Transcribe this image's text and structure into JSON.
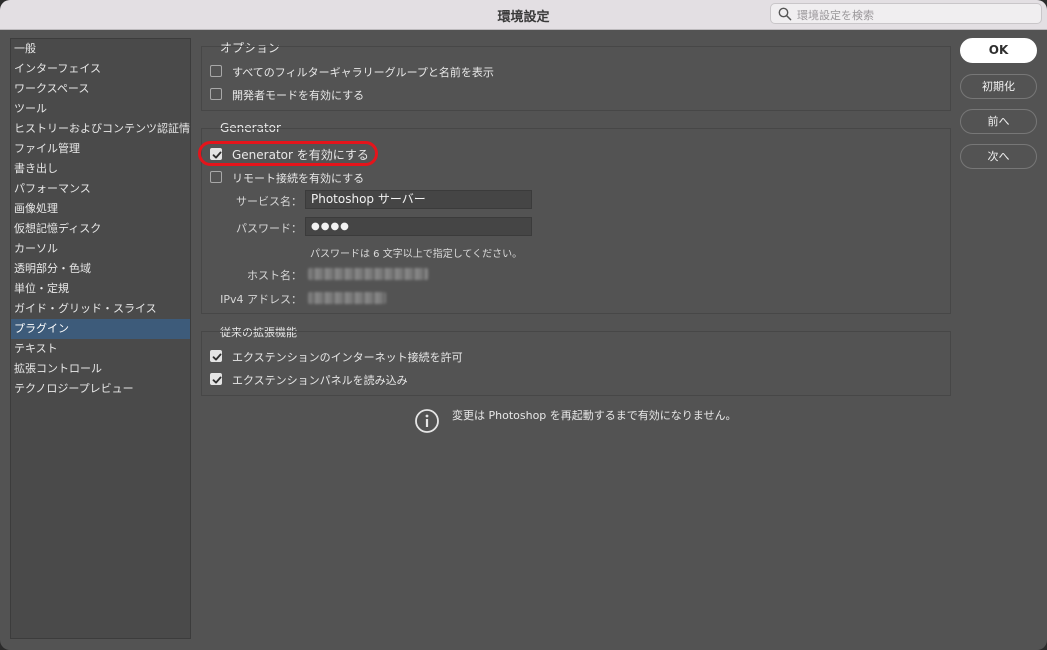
{
  "window": {
    "title": "環境設定"
  },
  "search": {
    "placeholder": "環境設定を検索"
  },
  "sidebar": {
    "items": [
      {
        "label": "一般"
      },
      {
        "label": "インターフェイス"
      },
      {
        "label": "ワークスペース"
      },
      {
        "label": "ツール"
      },
      {
        "label": "ヒストリーおよびコンテンツ認証情報"
      },
      {
        "label": "ファイル管理"
      },
      {
        "label": "書き出し"
      },
      {
        "label": "パフォーマンス"
      },
      {
        "label": "画像処理"
      },
      {
        "label": "仮想記憶ディスク"
      },
      {
        "label": "カーソル"
      },
      {
        "label": "透明部分・色域"
      },
      {
        "label": "単位・定規"
      },
      {
        "label": "ガイド・グリッド・スライス"
      },
      {
        "label": "プラグイン",
        "selected": true
      },
      {
        "label": "テキスト"
      },
      {
        "label": "拡張コントロール"
      },
      {
        "label": "テクノロジープレビュー"
      }
    ]
  },
  "options": {
    "title": "オプション",
    "show_all_filter_gallery": {
      "label": "すべてのフィルターギャラリーグループと名前を表示",
      "checked": false
    },
    "developer_mode": {
      "label": "開発者モードを有効にする",
      "checked": false
    }
  },
  "generator": {
    "title": "Generator",
    "enable": {
      "label": "Generator を有効にする",
      "checked": true
    },
    "remote": {
      "label": "リモート接続を有効にする",
      "checked": false
    },
    "service_label": "サービス名：",
    "service_value": "Photoshop サーバー",
    "password_label": "パスワード：",
    "password_value": "●●●●",
    "password_hint": "パスワードは 6 文字以上で指定してください。",
    "host_label": "ホスト名：",
    "ipv4_label": "IPv4 アドレス："
  },
  "legacy": {
    "title": "従来の拡張機能",
    "internet": {
      "label": "エクステンションのインターネット接続を許可",
      "checked": true
    },
    "panels": {
      "label": "エクステンションパネルを読み込み",
      "checked": true
    }
  },
  "notice": {
    "text": "変更は Photoshop を再起動するまで有効になりません。"
  },
  "buttons": {
    "ok": "OK",
    "reset": "初期化",
    "prev": "前へ",
    "next": "次へ"
  },
  "colors": {
    "panel_bg": "#535353",
    "selected_bg": "#3d5b7a",
    "highlight": "#e5141b"
  }
}
